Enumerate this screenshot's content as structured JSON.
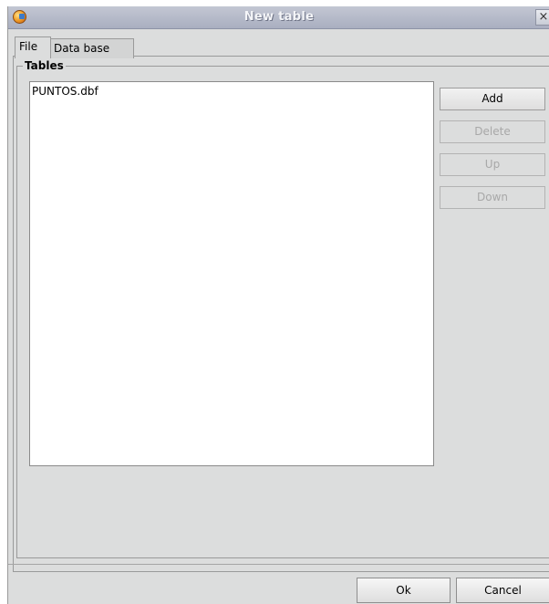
{
  "window": {
    "title": "New table",
    "close_glyph": "×",
    "icon": "gvsig-app-icon"
  },
  "tabs": [
    {
      "label": "File",
      "selected": true
    },
    {
      "label": "Data base",
      "selected": false
    }
  ],
  "tables_group": {
    "title": "Tables",
    "items": [
      "PUNTOS.dbf"
    ]
  },
  "side_buttons": {
    "add": {
      "label": "Add",
      "enabled": true
    },
    "delete": {
      "label": "Delete",
      "enabled": false
    },
    "up": {
      "label": "Up",
      "enabled": false
    },
    "down": {
      "label": "Down",
      "enabled": false
    }
  },
  "footer": {
    "ok_label": "Ok",
    "cancel_label": "Cancel"
  },
  "colors": {
    "dialog_bg": "#dcdddd",
    "titlebar": "#b6bbc9",
    "disabled_text": "#a8a8a8"
  }
}
